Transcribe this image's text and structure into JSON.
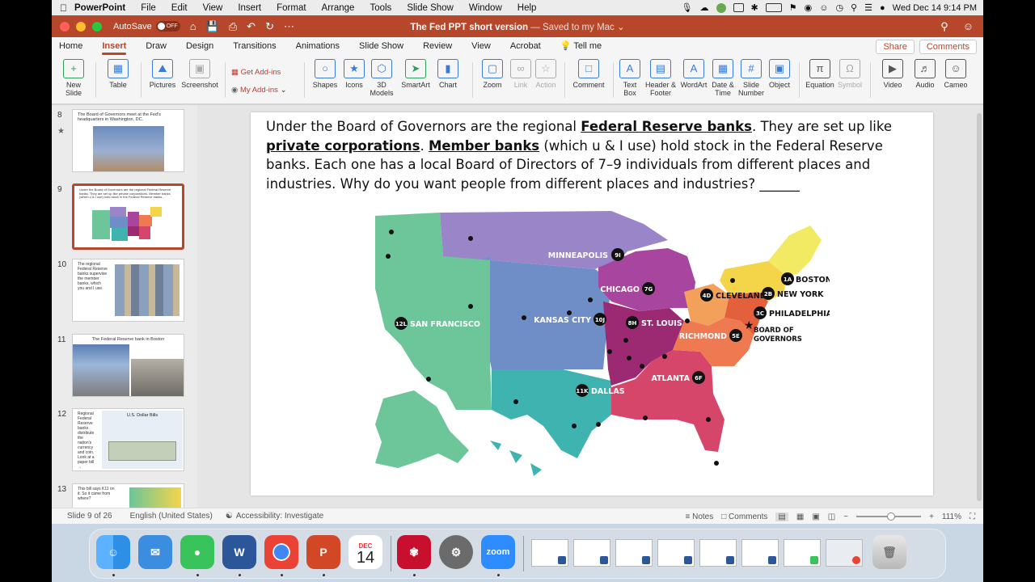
{
  "menubar": {
    "app": "PowerPoint",
    "items": [
      "File",
      "Edit",
      "View",
      "Insert",
      "Format",
      "Arrange",
      "Tools",
      "Slide Show",
      "Window",
      "Help"
    ],
    "clock": "Wed Dec 14  9:14 PM"
  },
  "titlebar": {
    "autosave": "AutoSave",
    "autosave_state": "OFF",
    "doc_title": "The Fed PPT short version",
    "doc_status": " — Saved to my Mac ⌄"
  },
  "tabs": {
    "items": [
      "Home",
      "Insert",
      "Draw",
      "Design",
      "Transitions",
      "Animations",
      "Slide Show",
      "Review",
      "View",
      "Acrobat",
      "Tell me"
    ],
    "active": "Insert",
    "share": "Share",
    "comments": "Comments"
  },
  "ribbon": {
    "new_slide": "New Slide",
    "table": "Table",
    "pictures": "Pictures",
    "screenshot": "Screenshot",
    "get_addins": "Get Add-ins",
    "my_addins": "My Add-ins",
    "shapes": "Shapes",
    "icons": "Icons",
    "models": "3D Models",
    "smartart": "SmartArt",
    "chart": "Chart",
    "zoom": "Zoom",
    "link": "Link",
    "action": "Action",
    "comment": "Comment",
    "textbox": "Text Box",
    "header_footer": "Header & Footer",
    "wordart": "WordArt",
    "date_time": "Date & Time",
    "slide_number": "Slide Number",
    "object": "Object",
    "equation": "Equation",
    "symbol": "Symbol",
    "video": "Video",
    "audio": "Audio",
    "cameo": "Cameo"
  },
  "thumbnails": [
    {
      "num": "8",
      "text": "The Board of Governors meet at the Fed's headquarters in Washington, DC."
    },
    {
      "num": "9",
      "text": "Under the Board of Governors are the regional Federal Reserve banks. They are set up like private corporations. Member banks (which u & I use) hold stock in the Federal Reserve banks..."
    },
    {
      "num": "10",
      "text": "The regional Federal Reserve banks supervise the member banks, which you and I use."
    },
    {
      "num": "11",
      "text": "The Federal Reserve bank in Boston"
    },
    {
      "num": "12",
      "text": "Regional Federal Reserve banks distribute the nation's currency and coin. Look at a paper bill →",
      "sub": "U.S. Dollar Bills"
    },
    {
      "num": "13",
      "text": "This bill says K11 on it. So it came from where?"
    }
  ],
  "slide": {
    "text_1": "Under the Board of Governors are the regional ",
    "bold_1": "Federal Reserve banks",
    "text_2": ". They are set up like ",
    "bold_2": "private corporations",
    "text_3": ". ",
    "bold_3": "Member banks",
    "text_4": " (which u & I use) hold stock in the Federal Reserve banks. Each one has a local Board of Directors of 7–9 individuals from different places and industries. Why do you want people from different places and industries? ______",
    "districts": [
      {
        "code": "1A",
        "city": "BOSTON"
      },
      {
        "code": "2B",
        "city": "NEW YORK"
      },
      {
        "code": "3C",
        "city": "PHILADELPHIA"
      },
      {
        "code": "4D",
        "city": "CLEVELAND"
      },
      {
        "code": "5E",
        "city": "RICHMOND"
      },
      {
        "code": "6F",
        "city": "ATLANTA"
      },
      {
        "code": "7G",
        "city": "CHICAGO"
      },
      {
        "code": "8H",
        "city": "ST. LOUIS"
      },
      {
        "code": "9I",
        "city": "MINNEAPOLIS"
      },
      {
        "code": "10J",
        "city": "KANSAS CITY"
      },
      {
        "code": "11K",
        "city": "DALLAS"
      },
      {
        "code": "12L",
        "city": "SAN FRANCISCO"
      }
    ],
    "hq_line1": "BOARD OF",
    "hq_line2": "GOVERNORS"
  },
  "status": {
    "slide": "Slide 9 of 26",
    "language": "English (United States)",
    "accessibility": "Accessibility: Investigate",
    "notes": "Notes",
    "comments": "Comments",
    "zoom": "111%"
  },
  "dock": {
    "calendar_month": "DEC",
    "calendar_day": "14",
    "zoom_label": "zoom"
  },
  "colors": {
    "accent": "#b7472a",
    "san_francisco": "#6dc59a",
    "minneapolis": "#9b85c9",
    "kansas_city": "#6f8dc6",
    "dallas": "#3fb3b0",
    "chicago": "#a8459e",
    "st_louis": "#9b2a72",
    "atlanta": "#d6456a",
    "cleveland": "#f2a05a",
    "richmond": "#ef7a52",
    "philadelphia": "#e4603c",
    "new_york": "#f4d54a",
    "boston": "#f3ea63"
  }
}
